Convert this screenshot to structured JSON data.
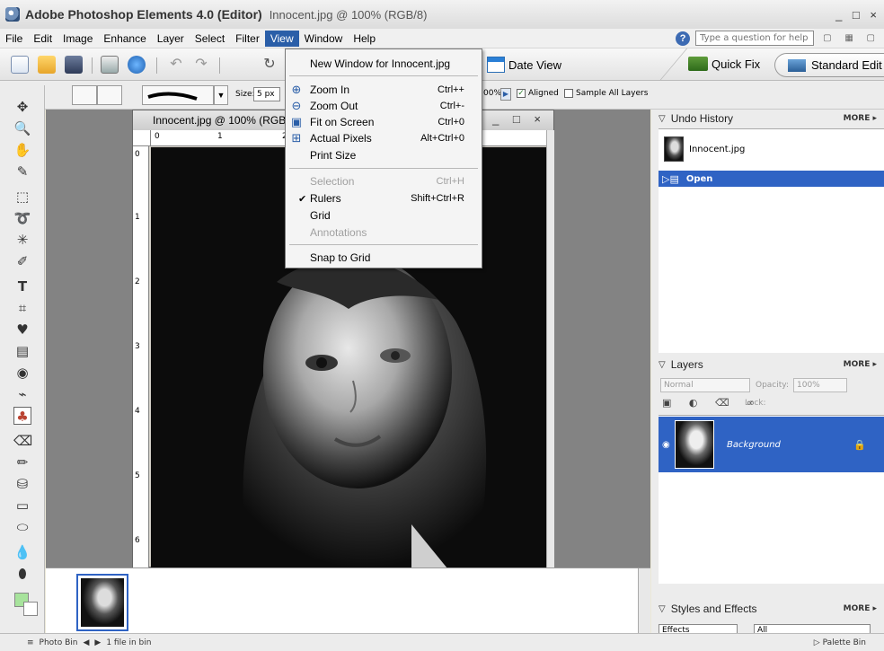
{
  "window": {
    "app_title": "Adobe Photoshop Elements 4.0 (Editor)",
    "doc_title": "Innocent.jpg @ 100% (RGB/8)",
    "controls": "_ □ ×"
  },
  "menubar": {
    "items": [
      "File",
      "Edit",
      "Image",
      "Enhance",
      "Layer",
      "Select",
      "Filter",
      "View",
      "Window",
      "Help"
    ],
    "active": "View",
    "help_placeholder": "Type a question for help"
  },
  "shortcuts": {
    "date_view": "Date View",
    "quick_fix": "Quick Fix",
    "standard_edit": "Standard Edit"
  },
  "options": {
    "size_label": "Size:",
    "size_value": "5 px",
    "opacity_fragment": "00%",
    "aligned_label": "Aligned",
    "aligned_checked": true,
    "sample_all_label": "Sample All Layers",
    "sample_all_checked": false
  },
  "document": {
    "title": "Innocent.jpg @ 100% (RGB/",
    "controls": "_ □ ×",
    "ruler_top": [
      "0",
      "1",
      "2"
    ],
    "ruler_left": [
      "0",
      "1",
      "2",
      "3",
      "4",
      "5",
      "6"
    ]
  },
  "view_menu": {
    "items": [
      {
        "label": "New Window for Innocent.jpg",
        "shortcut": "",
        "disabled": false,
        "icon": "",
        "checked": false
      },
      {
        "label": "Zoom In",
        "shortcut": "Ctrl++",
        "disabled": false,
        "icon": "zoom-in-icon",
        "checked": false
      },
      {
        "label": "Zoom Out",
        "shortcut": "Ctrl+-",
        "disabled": false,
        "icon": "zoom-out-icon",
        "checked": false
      },
      {
        "label": "Fit on Screen",
        "shortcut": "Ctrl+0",
        "disabled": false,
        "icon": "fit-screen-icon",
        "checked": false
      },
      {
        "label": "Actual Pixels",
        "shortcut": "Alt+Ctrl+0",
        "disabled": false,
        "icon": "actual-pixels-icon",
        "checked": false
      },
      {
        "label": "Print Size",
        "shortcut": "",
        "disabled": false,
        "icon": "",
        "checked": false
      },
      {
        "label": "Selection",
        "shortcut": "Ctrl+H",
        "disabled": true,
        "icon": "",
        "checked": false
      },
      {
        "label": "Rulers",
        "shortcut": "Shift+Ctrl+R",
        "disabled": false,
        "icon": "",
        "checked": true
      },
      {
        "label": "Grid",
        "shortcut": "",
        "disabled": false,
        "icon": "",
        "checked": false
      },
      {
        "label": "Annotations",
        "shortcut": "",
        "disabled": true,
        "icon": "",
        "checked": false
      },
      {
        "label": "Snap to Grid",
        "shortcut": "",
        "disabled": false,
        "icon": "",
        "checked": false
      }
    ]
  },
  "undo_history": {
    "title": "Undo History",
    "more": "MORE ▸",
    "rows": [
      {
        "label": "Innocent.jpg"
      },
      {
        "label": "Open"
      }
    ]
  },
  "layers": {
    "title": "Layers",
    "more": "MORE ▸",
    "blend_mode": "Normal",
    "opacity_label": "Opacity:",
    "opacity_value": "100%",
    "lock_label": "Lock:",
    "layer_name": "Background"
  },
  "styles_effects": {
    "title": "Styles and Effects",
    "more": "MORE ▸",
    "category": "Effects",
    "filter": "All"
  },
  "statusbar": {
    "photo_bin": "Photo Bin",
    "files_count": "1 file in bin",
    "palette_bin": "Palette Bin"
  },
  "colors": {
    "accent": "#2f63c4",
    "foreground_swatch": "#a7e39c",
    "background_swatch": "#ffffff"
  }
}
